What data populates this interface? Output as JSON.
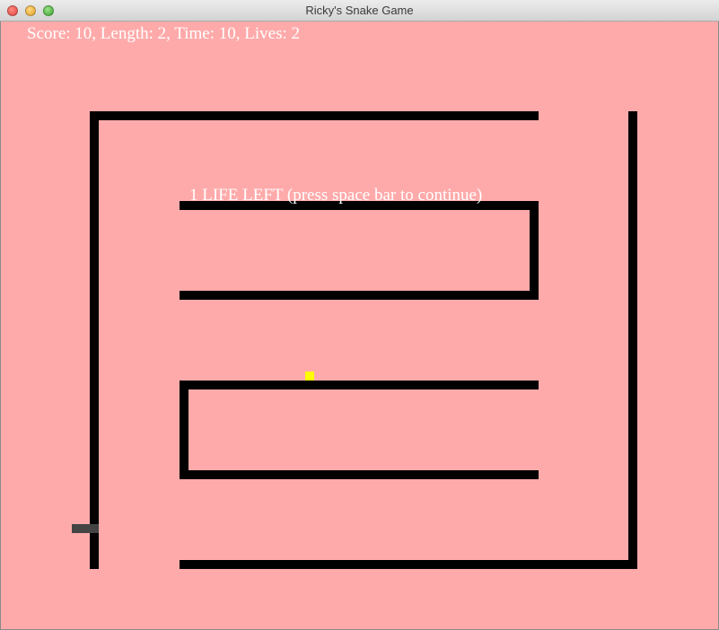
{
  "window": {
    "title": "Ricky's Snake Game"
  },
  "hud": {
    "status_text": "Score: 10, Length: 2, Time: 10, Lives: 2"
  },
  "message": {
    "text": "1 LIFE LEFT (press space bar to continue)"
  },
  "colors": {
    "background": "#ffaaaa",
    "walls": "#000000",
    "food": "#ffff00",
    "snake": "#444444",
    "text": "#ffffff"
  }
}
